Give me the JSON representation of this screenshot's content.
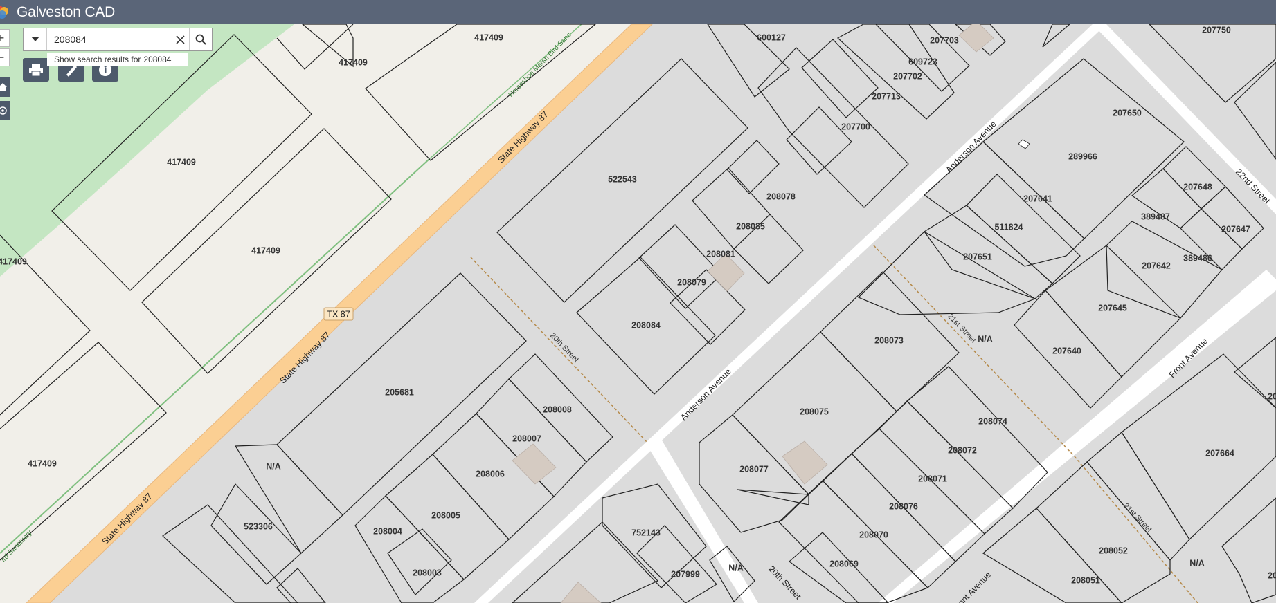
{
  "app": {
    "title": "Galveston CAD"
  },
  "search": {
    "value": "208084",
    "suggestion_prefix": "Show search results for",
    "suggestion_term": "208084"
  },
  "parcels": [
    {
      "id": "p1",
      "label": "417409"
    },
    {
      "id": "p2",
      "label": "417409"
    },
    {
      "id": "p3",
      "label": "417409"
    },
    {
      "id": "p4",
      "label": "417409"
    },
    {
      "id": "p5",
      "label": "417409"
    },
    {
      "id": "p6",
      "label": "417409"
    },
    {
      "id": "p7",
      "label": "600127"
    },
    {
      "id": "p8",
      "label": "207703"
    },
    {
      "id": "p9",
      "label": "609723"
    },
    {
      "id": "p10",
      "label": "207702"
    },
    {
      "id": "p11",
      "label": "207713"
    },
    {
      "id": "p12",
      "label": "207700"
    },
    {
      "id": "p13",
      "label": "207750"
    },
    {
      "id": "p14",
      "label": "207650"
    },
    {
      "id": "p15",
      "label": "289966"
    },
    {
      "id": "p16",
      "label": "207641"
    },
    {
      "id": "p17",
      "label": "511824"
    },
    {
      "id": "p18",
      "label": "207651"
    },
    {
      "id": "p19",
      "label": "207648"
    },
    {
      "id": "p20",
      "label": "389487"
    },
    {
      "id": "p21",
      "label": "207647"
    },
    {
      "id": "p22",
      "label": "389486"
    },
    {
      "id": "p23",
      "label": "207642"
    },
    {
      "id": "p24",
      "label": "207645"
    },
    {
      "id": "p25",
      "label": "207640"
    },
    {
      "id": "p26",
      "label": "522543"
    },
    {
      "id": "p27",
      "label": "208078"
    },
    {
      "id": "p28",
      "label": "208085"
    },
    {
      "id": "p29",
      "label": "208081"
    },
    {
      "id": "p30",
      "label": "208079"
    },
    {
      "id": "p31",
      "label": "208084"
    },
    {
      "id": "p32",
      "label": "205681"
    },
    {
      "id": "p33",
      "label": "208008"
    },
    {
      "id": "p34",
      "label": "208007"
    },
    {
      "id": "p35",
      "label": "208006"
    },
    {
      "id": "p36",
      "label": "208005"
    },
    {
      "id": "p37",
      "label": "208004"
    },
    {
      "id": "p38",
      "label": "208003"
    },
    {
      "id": "p39",
      "label": "N/A"
    },
    {
      "id": "p40",
      "label": "523306"
    },
    {
      "id": "p41",
      "label": "208073"
    },
    {
      "id": "p42",
      "label": "208075"
    },
    {
      "id": "p43",
      "label": "208077"
    },
    {
      "id": "p44",
      "label": "208074"
    },
    {
      "id": "p45",
      "label": "208072"
    },
    {
      "id": "p46",
      "label": "208071"
    },
    {
      "id": "p47",
      "label": "208076"
    },
    {
      "id": "p48",
      "label": "208070"
    },
    {
      "id": "p49",
      "label": "208069"
    },
    {
      "id": "p50",
      "label": "752143"
    },
    {
      "id": "p51",
      "label": "207999"
    },
    {
      "id": "p52",
      "label": "N/A"
    },
    {
      "id": "p53",
      "label": "N/A"
    },
    {
      "id": "p54",
      "label": "207664"
    },
    {
      "id": "p55",
      "label": "208052"
    },
    {
      "id": "p56",
      "label": "208051"
    },
    {
      "id": "p57",
      "label": "N/A"
    },
    {
      "id": "p58",
      "label": "20"
    },
    {
      "id": "p59",
      "label": "20"
    }
  ],
  "streets": [
    {
      "id": "s1",
      "label": "State Highway 87"
    },
    {
      "id": "s2",
      "label": "State Highway 87"
    },
    {
      "id": "s3",
      "label": "State Highway 87"
    },
    {
      "id": "s4",
      "label": "TX 87"
    },
    {
      "id": "s5",
      "label": "Anderson Avenue"
    },
    {
      "id": "s6",
      "label": "Anderson Avenue"
    },
    {
      "id": "s7",
      "label": "20th Street"
    },
    {
      "id": "s8",
      "label": "20th Street"
    },
    {
      "id": "s9",
      "label": "21st Street"
    },
    {
      "id": "s10",
      "label": "21st Street"
    },
    {
      "id": "s11",
      "label": "22nd Street"
    },
    {
      "id": "s12",
      "label": "Front Avenue"
    },
    {
      "id": "s13",
      "label": "ont Avenue"
    }
  ],
  "parks": [
    {
      "id": "k1",
      "label": "Horseshoe Marsh Bird Sanc"
    },
    {
      "id": "k2",
      "label": "ird Sanctuary"
    }
  ],
  "colors": {
    "header": "#5a6578",
    "highway": "#fbcf93",
    "park": "#c4e6c2",
    "land": "#f1efe9",
    "block": "#dcdcdc",
    "street": "#ffffff",
    "tool_button": "#4d5a6b"
  },
  "icons": [
    "app-logo-icon",
    "chevron-down-icon",
    "close-icon",
    "search-icon",
    "print-icon",
    "measure-icon",
    "info-icon",
    "home-icon",
    "locate-icon",
    "plus-icon",
    "minus-icon"
  ]
}
